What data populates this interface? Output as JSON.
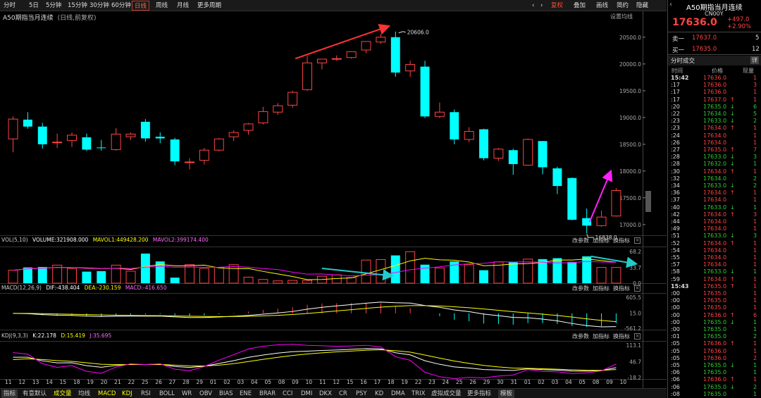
{
  "toolbar": {
    "periods": [
      "分时",
      "5日",
      "5分钟",
      "15分钟",
      "30分钟",
      "60分钟",
      "日线",
      "周线",
      "月线",
      "更多周期"
    ],
    "active_period": "日线",
    "right_buttons": [
      "复权",
      "叠加",
      "画线",
      "简约",
      "隐藏"
    ],
    "prev_icon": "‹",
    "next_icon": "›"
  },
  "chart": {
    "title": "A50期指当月连续",
    "subtitle": "(日线,前复权)",
    "settings_label": "设置均线",
    "high_label": "20606.0",
    "low_label": "16838.0",
    "y_axis": [
      "20500.0",
      "20000.0",
      "19500.0",
      "19000.0",
      "18500.0",
      "18000.0",
      "17500.0",
      "17000.0"
    ],
    "x_axis": [
      "11",
      "12",
      "13",
      "14",
      "15",
      "18",
      "19",
      "20",
      "21",
      "22",
      "25",
      "26",
      "27",
      "28",
      "29",
      "01",
      "02",
      "03",
      "04",
      "05",
      "08",
      "09",
      "10",
      "11",
      "12",
      "15",
      "16",
      "17",
      "18",
      "19",
      "22",
      "23",
      "24",
      "25",
      "26",
      "29",
      "30",
      "31",
      "01",
      "02",
      "03",
      "04",
      "05",
      "08",
      "09",
      "10"
    ],
    "colors": {
      "up": "#ff4444",
      "down": "#00ffff",
      "bg": "#000000",
      "ma5": "#ffffff",
      "ma10": "#ffff00",
      "ma20": "#ff00ff"
    }
  },
  "chart_data": {
    "type": "candlestick",
    "ylim": [
      16800,
      20800
    ],
    "candles": [
      {
        "o": 18600,
        "h": 19020,
        "l": 18350,
        "c": 18970
      },
      {
        "o": 18960,
        "h": 19100,
        "l": 18790,
        "c": 18830
      },
      {
        "o": 18830,
        "h": 18900,
        "l": 18420,
        "c": 18500
      },
      {
        "o": 18530,
        "h": 18700,
        "l": 18430,
        "c": 18540
      },
      {
        "o": 18570,
        "h": 18720,
        "l": 18450,
        "c": 18670
      },
      {
        "o": 18630,
        "h": 18700,
        "l": 18380,
        "c": 18400
      },
      {
        "o": 18440,
        "h": 18580,
        "l": 18380,
        "c": 18430
      },
      {
        "o": 18400,
        "h": 18800,
        "l": 18380,
        "c": 18690
      },
      {
        "o": 18640,
        "h": 18720,
        "l": 18580,
        "c": 18690
      },
      {
        "o": 18920,
        "h": 18970,
        "l": 18550,
        "c": 18610
      },
      {
        "o": 18640,
        "h": 18720,
        "l": 18520,
        "c": 18610
      },
      {
        "o": 18590,
        "h": 18620,
        "l": 18110,
        "c": 18180
      },
      {
        "o": 18170,
        "h": 18240,
        "l": 18030,
        "c": 18170
      },
      {
        "o": 18200,
        "h": 18430,
        "l": 18120,
        "c": 18390
      },
      {
        "o": 18390,
        "h": 18620,
        "l": 18370,
        "c": 18600
      },
      {
        "o": 18640,
        "h": 18760,
        "l": 18560,
        "c": 18720
      },
      {
        "o": 18760,
        "h": 18900,
        "l": 18680,
        "c": 18880
      },
      {
        "o": 18900,
        "h": 19200,
        "l": 18870,
        "c": 19110
      },
      {
        "o": 19100,
        "h": 19270,
        "l": 19050,
        "c": 19220
      },
      {
        "o": 19230,
        "h": 19500,
        "l": 19180,
        "c": 19470
      },
      {
        "o": 19520,
        "h": 20150,
        "l": 19500,
        "c": 20020
      },
      {
        "o": 20020,
        "h": 20070,
        "l": 19900,
        "c": 20090
      },
      {
        "o": 20090,
        "h": 20160,
        "l": 20060,
        "c": 20100
      },
      {
        "o": 20120,
        "h": 20200,
        "l": 20100,
        "c": 20230
      },
      {
        "o": 20260,
        "h": 20330,
        "l": 20200,
        "c": 20420
      },
      {
        "o": 20410,
        "h": 20560,
        "l": 20380,
        "c": 20500
      },
      {
        "o": 20500,
        "h": 20606,
        "l": 19760,
        "c": 19840
      },
      {
        "o": 19870,
        "h": 20060,
        "l": 19760,
        "c": 19990
      },
      {
        "o": 19950,
        "h": 20060,
        "l": 18990,
        "c": 19020
      },
      {
        "o": 19020,
        "h": 19280,
        "l": 18990,
        "c": 19100
      },
      {
        "o": 19100,
        "h": 19150,
        "l": 18500,
        "c": 18590
      },
      {
        "o": 18590,
        "h": 18820,
        "l": 18540,
        "c": 18740
      },
      {
        "o": 18780,
        "h": 18790,
        "l": 18200,
        "c": 18240
      },
      {
        "o": 18240,
        "h": 18430,
        "l": 18190,
        "c": 18410
      },
      {
        "o": 18390,
        "h": 18420,
        "l": 17930,
        "c": 18130
      },
      {
        "o": 18110,
        "h": 18610,
        "l": 18100,
        "c": 18590
      },
      {
        "o": 18560,
        "h": 18560,
        "l": 17940,
        "c": 18070
      },
      {
        "o": 18050,
        "h": 18080,
        "l": 17570,
        "c": 17720
      },
      {
        "o": 17870,
        "h": 17880,
        "l": 17080,
        "c": 17090
      },
      {
        "o": 17120,
        "h": 17300,
        "l": 16838,
        "c": 16980
      },
      {
        "o": 16980,
        "h": 17260,
        "l": 16960,
        "c": 17140
      },
      {
        "o": 17160,
        "h": 17680,
        "l": 17150,
        "c": 17636
      }
    ],
    "volume": [
      28,
      34,
      35,
      39,
      32,
      25,
      26,
      39,
      26,
      64,
      47,
      12,
      40,
      32,
      34,
      40,
      13,
      8,
      5,
      6,
      6,
      15,
      18,
      12,
      50,
      51,
      60,
      68,
      40,
      33,
      47,
      40,
      28,
      46,
      46,
      52,
      52,
      54,
      46,
      58,
      34,
      34
    ],
    "volume_axis": [
      "68.2",
      "33.7",
      "0.0"
    ],
    "macd_axis": [
      "605.5",
      "15.0",
      "-561.2"
    ],
    "kdj_axis": [
      "113.1",
      "46.7",
      "-18.2"
    ]
  },
  "indicators": {
    "vol": {
      "head": "VOL(5,10)",
      "volume": "VOLUME:321908.000",
      "ma1": "MAVOL1:449428.200",
      "ma2": "MAVOL2:399174.400"
    },
    "macd": {
      "head": "MACD(12,26,9)",
      "dif": "DIF:-438.404",
      "dea": "DEA:-230.159",
      "macd": "MACD:-416.650"
    },
    "kdj": {
      "head": "KDJ(9,3,3)",
      "k": "K:22.178",
      "d": "D:15.419",
      "j": "J:35.695"
    },
    "buttons": [
      "改参数",
      "加指标",
      "换指标"
    ]
  },
  "bottom_tabs": [
    "指标",
    "有意默认",
    "成交量",
    "均线",
    "MACD",
    "KDJ",
    "RSI",
    "BOLL",
    "WR",
    "OBV",
    "BIAS",
    "ENE",
    "BRAR",
    "CCI",
    "DMI",
    "DKX",
    "CR",
    "PSY",
    "KD",
    "DMA",
    "TRIX",
    "虚拟成交量",
    "更多指标",
    "模板"
  ],
  "quote": {
    "name": "A50期指当月连续",
    "code": "CN00Y",
    "price": "17636.0",
    "change": "+497.0",
    "change_pct": "+2.90%",
    "sell_label": "卖一",
    "sell_price": "17637.0",
    "sell_vol": "5",
    "buy_label": "买一",
    "buy_price": "17635.0",
    "buy_vol": "12",
    "ticks_title": "分时成交",
    "ticks_btn": "详",
    "col_time": "时间",
    "col_price": "价格",
    "col_vol": "现量"
  },
  "ticks": [
    {
      "t": "15:42",
      "p": "17636.0",
      "a": "",
      "v": "1",
      "c": "up"
    },
    {
      "t": ":17",
      "p": "17636.0",
      "a": "",
      "v": "3",
      "c": "up"
    },
    {
      "t": ":17",
      "p": "17636.0",
      "a": "",
      "v": "1",
      "c": "up"
    },
    {
      "t": ":17",
      "p": "17637.0",
      "a": "↑",
      "v": "1",
      "c": "up"
    },
    {
      "t": ":20",
      "p": "17635.0",
      "a": "↓",
      "v": "6",
      "c": "dn"
    },
    {
      "t": ":22",
      "p": "17634.0",
      "a": "↓",
      "v": "5",
      "c": "dn"
    },
    {
      "t": ":23",
      "p": "17633.0",
      "a": "↓",
      "v": "2",
      "c": "dn"
    },
    {
      "t": ":23",
      "p": "17634.0",
      "a": "↑",
      "v": "1",
      "c": "up"
    },
    {
      "t": ":24",
      "p": "17634.0",
      "a": "",
      "v": "1",
      "c": "up"
    },
    {
      "t": ":26",
      "p": "17634.0",
      "a": "",
      "v": "1",
      "c": "up"
    },
    {
      "t": ":27",
      "p": "17635.0",
      "a": "↑",
      "v": "7",
      "c": "up"
    },
    {
      "t": ":28",
      "p": "17633.0",
      "a": "↓",
      "v": "3",
      "c": "dn"
    },
    {
      "t": ":28",
      "p": "17632.0",
      "a": "↓",
      "v": "1",
      "c": "dn"
    },
    {
      "t": ":30",
      "p": "17634.0",
      "a": "↑",
      "v": "1",
      "c": "up"
    },
    {
      "t": ":32",
      "p": "17634.0",
      "a": "",
      "v": "2",
      "c": "dn"
    },
    {
      "t": ":34",
      "p": "17633.0",
      "a": "↓",
      "v": "2",
      "c": "dn"
    },
    {
      "t": ":36",
      "p": "17634.0",
      "a": "↑",
      "v": "1",
      "c": "up"
    },
    {
      "t": ":37",
      "p": "17634.0",
      "a": "",
      "v": "1",
      "c": "up"
    },
    {
      "t": ":40",
      "p": "17633.0",
      "a": "↓",
      "v": "1",
      "c": "dn"
    },
    {
      "t": ":42",
      "p": "17634.0",
      "a": "↑",
      "v": "3",
      "c": "up"
    },
    {
      "t": ":44",
      "p": "17634.0",
      "a": "",
      "v": "1",
      "c": "up"
    },
    {
      "t": ":49",
      "p": "17634.0",
      "a": "",
      "v": "1",
      "c": "up"
    },
    {
      "t": ":51",
      "p": "17633.0",
      "a": "↓",
      "v": "3",
      "c": "dn"
    },
    {
      "t": ":52",
      "p": "17634.0",
      "a": "↑",
      "v": "1",
      "c": "up"
    },
    {
      "t": ":54",
      "p": "17634.0",
      "a": "",
      "v": "1",
      "c": "up"
    },
    {
      "t": ":55",
      "p": "17634.0",
      "a": "",
      "v": "1",
      "c": "up"
    },
    {
      "t": ":57",
      "p": "17634.0",
      "a": "",
      "v": "1",
      "c": "up"
    },
    {
      "t": ":58",
      "p": "17633.0",
      "a": "↓",
      "v": "1",
      "c": "dn"
    },
    {
      "t": ":59",
      "p": "17634.0",
      "a": "↑",
      "v": "1",
      "c": "up"
    },
    {
      "t": "15:43",
      "p": "17635.0",
      "a": "↑",
      "v": "1",
      "c": "up"
    },
    {
      "t": ":00",
      "p": "17635.0",
      "a": "",
      "v": "1",
      "c": "up"
    },
    {
      "t": ":00",
      "p": "17635.0",
      "a": "",
      "v": "1",
      "c": "up"
    },
    {
      "t": ":00",
      "p": "17635.0",
      "a": "",
      "v": "1",
      "c": "up"
    },
    {
      "t": ":00",
      "p": "17636.0",
      "a": "↑",
      "v": "6",
      "c": "up"
    },
    {
      "t": ":00",
      "p": "17635.0",
      "a": "↓",
      "v": "1",
      "c": "dn"
    },
    {
      "t": ":00",
      "p": "17635.0",
      "a": "",
      "v": "1",
      "c": "dn"
    },
    {
      "t": ":01",
      "p": "17635.0",
      "a": "",
      "v": "2",
      "c": "dn"
    },
    {
      "t": ":05",
      "p": "17636.0",
      "a": "↑",
      "v": "1",
      "c": "up"
    },
    {
      "t": ":05",
      "p": "17636.0",
      "a": "",
      "v": "1",
      "c": "up"
    },
    {
      "t": ":05",
      "p": "17636.0",
      "a": "",
      "v": "2",
      "c": "up"
    },
    {
      "t": ":05",
      "p": "17635.0",
      "a": "↓",
      "v": "1",
      "c": "dn"
    },
    {
      "t": ":06",
      "p": "17635.0",
      "a": "",
      "v": "1",
      "c": "dn"
    },
    {
      "t": ":06",
      "p": "17636.0",
      "a": "↑",
      "v": "1",
      "c": "up"
    },
    {
      "t": ":06",
      "p": "17635.0",
      "a": "↓",
      "v": "2",
      "c": "dn"
    },
    {
      "t": ":08",
      "p": "17635.0",
      "a": "",
      "v": "1",
      "c": "dn"
    }
  ]
}
